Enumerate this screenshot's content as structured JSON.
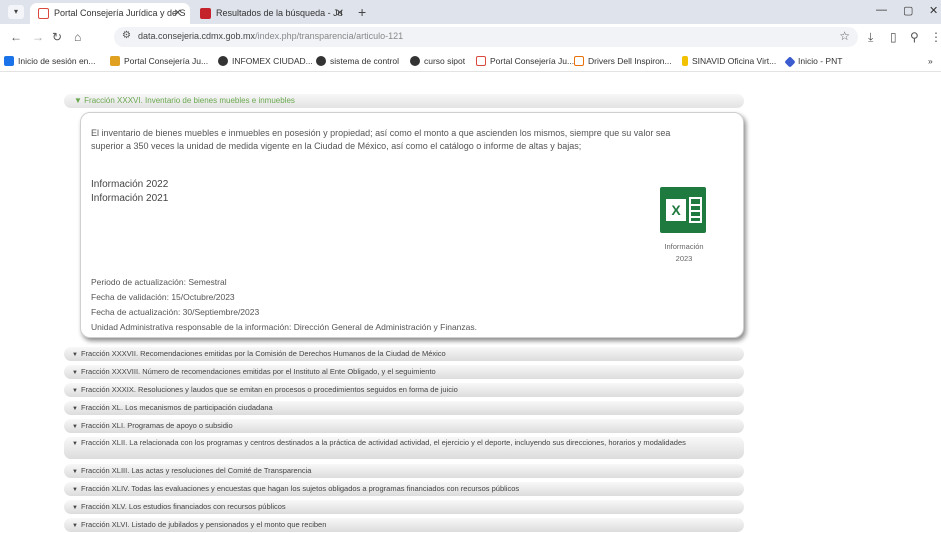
{
  "browser": {
    "tabs": [
      {
        "title": "Portal Consejería Jurídica y de S",
        "close": "✕"
      },
      {
        "title": "Resultados de la búsqueda - Ju",
        "close": "✕"
      }
    ],
    "new_tab": "+",
    "window_controls": [
      "—",
      "▢",
      "✕"
    ],
    "url_host": "data.consejeria.cdmx.gob.mx",
    "url_path": "/index.php/transparencia/articulo-121",
    "bookmarks": [
      {
        "label": "Inicio de sesión en...",
        "color": "#1a73e8"
      },
      {
        "label": "Portal Consejería Ju...",
        "color": "#e0a020"
      },
      {
        "label": "INFOMEX CIUDAD...",
        "color": "#333333"
      },
      {
        "label": "sistema de control",
        "color": "#333333"
      },
      {
        "label": "curso sipot",
        "color": "#333333"
      },
      {
        "label": "Portal Consejería Ju...",
        "color": "#d9493d"
      },
      {
        "label": "Drivers Dell Inspiron...",
        "color": "#e8710a"
      },
      {
        "label": "SINAVID Oficina Virt...",
        "color": "#f2c200"
      },
      {
        "label": "Inicio - PNT",
        "color": "#3b5ccf"
      }
    ],
    "bookmarks_more": "»"
  },
  "content": {
    "open_header": "▼ Fracción XXXVI. Inventario de bienes muebles e inmuebles",
    "description": "El inventario de bienes muebles e inmuebles en posesión y propiedad; así como el monto a que ascienden los mismos, siempre que su valor sea superior a 350 veces la unidad de medida vigente en la Ciudad de México, así como el catálogo o informe de altas y bajas;",
    "info_2022": "Información 2022",
    "info_2021": "Información 2021",
    "excel_caption_1": "Información",
    "excel_caption_2": "2023",
    "excel_letter": "X",
    "periodo": "Periodo de actualización: Semestral",
    "validacion": "Fecha de validación: 15/Octubre/2023",
    "actualizacion": "Fecha de actualización: 30/Septiembre/2023",
    "unidad": "Unidad Administrativa responsable de la información: Dirección General de Administración y Finanzas.",
    "fractions": [
      "Fracción XXXVII. Recomendaciones emitidas por la Comisión de Derechos Humanos de la Ciudad de México",
      "Fracción XXXVIII. Número de recomendaciones emitidas por el Instituto al Ente Obligado, y el seguimiento",
      "Fracción XXXIX. Resoluciones y laudos que se emitan en procesos o procedimientos seguidos en forma de juicio",
      "Fracción XL. Los mecanismos de participación ciudadana",
      "Fracción XLI. Programas de apoyo o subsidio",
      "Fracción XLII. La relacionada con los programas y centros destinados a la práctica de actividad actividad, el ejercicio y el deporte, incluyendo sus direcciones, horarios y modalidades",
      "Fracción XLIII. Las actas y resoluciones del Comité de Transparencia",
      "Fracción XLIV. Todas las evaluaciones y encuestas que hagan los sujetos obligados a programas financiados con recursos públicos",
      "Fracción XLV. Los estudios financiados con recursos públicos",
      "Fracción XLVI. Listado de jubilados y pensionados y el monto que reciben"
    ],
    "fraction_marker": "▼"
  },
  "colors": {
    "excel_green": "#1f7a3f",
    "header_green": "#6aa84f"
  }
}
